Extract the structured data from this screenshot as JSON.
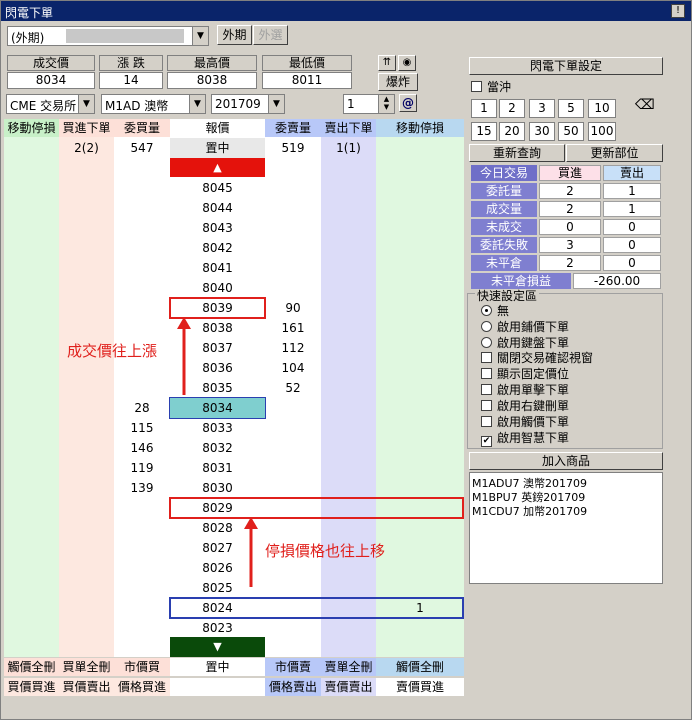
{
  "window": {
    "title": "閃電下單",
    "corner_btn": "!"
  },
  "top": {
    "account_select": "(外期)",
    "tab_foreign": "外期",
    "tab_foreign_option": "外選"
  },
  "quote_headers": [
    "成交價",
    "漲 跌",
    "最高價",
    "最低價"
  ],
  "quote_values": [
    "8034",
    "14",
    "8038",
    "8011"
  ],
  "explode_btn": "爆炸",
  "selectors": {
    "exchange": "CME 交易所",
    "product": "M1AD  澳幣",
    "month": "201709",
    "qty": "1"
  },
  "ladder_headers": [
    "移動停損",
    "買進下單",
    "委買量",
    "報價",
    "委賣量",
    "賣出下單",
    "移動停損"
  ],
  "summary_row": {
    "buy_order": "2(2)",
    "bid_total": "547",
    "center": "置中",
    "ask_total": "519",
    "sell_order": "1(1)"
  },
  "up_arrow": "▲",
  "down_arrow": "▼",
  "prices": [
    "8045",
    "8044",
    "8043",
    "8042",
    "8041",
    "8040",
    "8039",
    "8038",
    "8037",
    "8036",
    "8035",
    "8034",
    "8033",
    "8032",
    "8031",
    "8030",
    "8029",
    "8028",
    "8027",
    "8026",
    "8025",
    "8024",
    "8023"
  ],
  "ask_qty": {
    "8039": "90",
    "8038": "161",
    "8037": "112",
    "8036": "104",
    "8035": "52"
  },
  "bid_qty": {
    "8034": "28",
    "8033": "115",
    "8032": "146",
    "8031": "119",
    "8030": "139"
  },
  "stop_sell": {
    "8024": "1"
  },
  "annotations": {
    "up_text": "成交價往上漲",
    "stop_text": "停損價格也往上移"
  },
  "footer_row1": [
    "觸價全刪",
    "買單全刪",
    "市價買",
    "置中",
    "市價賣",
    "賣單全刪",
    "觸價全刪"
  ],
  "footer_row2": [
    "買價買進",
    "買價賣出",
    "價格買進",
    "",
    "價格賣出",
    "賣價賣出",
    "賣價買進"
  ],
  "right": {
    "settings_btn": "閃電下單設定",
    "day_trade": "當沖",
    "qty_buttons_row1": [
      "1",
      "2",
      "3",
      "5",
      "10"
    ],
    "qty_buttons_row2": [
      "15",
      "20",
      "30",
      "50",
      "100"
    ],
    "requery_btn": "重新查詢",
    "refresh_btn": "更新部位",
    "stats_header": [
      "今日交易",
      "買進",
      "賣出"
    ],
    "stats": [
      {
        "label": "委託量",
        "buy": "2",
        "sell": "1"
      },
      {
        "label": "成交量",
        "buy": "2",
        "sell": "1"
      },
      {
        "label": "未成交",
        "buy": "0",
        "sell": "0"
      },
      {
        "label": "委託失敗",
        "buy": "3",
        "sell": "0"
      },
      {
        "label": "未平倉",
        "buy": "2",
        "sell": "0"
      }
    ],
    "pnl_label": "未平倉損益",
    "pnl_value": "-260.00",
    "quick_title": "快速設定區",
    "radios": [
      "無",
      "啟用鋪價下單",
      "啟用鍵盤下單"
    ],
    "checks": [
      "關閉交易確認視窗",
      "顯示固定價位",
      "啟用單擊下單",
      "啟用右鍵刪單",
      "啟用觸價下單",
      "啟用智慧下單"
    ],
    "add_btn": "加入商品",
    "products": [
      "M1ADU7 澳幣201709",
      "M1BPU7 英鎊201709",
      "M1CDU7 加幣201709"
    ]
  },
  "colors": {
    "title_bar": "#0a246a",
    "buy_col": "#fde8e0",
    "sell_col": "#dcdcf8",
    "stop_col": "#e0f8e0",
    "highlight_red": "#e0201c",
    "highlight_blue": "#2a3fb0",
    "last_price": "#7fcfcf"
  }
}
